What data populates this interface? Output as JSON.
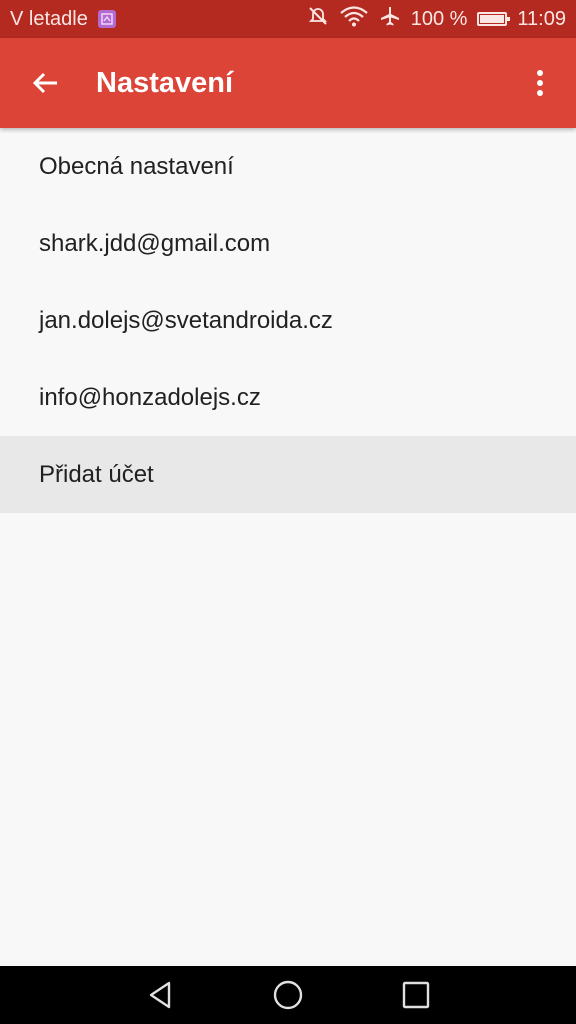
{
  "status_bar": {
    "carrier": "V letadle",
    "battery": "100 %",
    "battery_level": 1.0,
    "time": "11:09",
    "icons": [
      "app-notification-icon",
      "mute-icon",
      "wifi-icon",
      "airplane-icon",
      "battery-icon"
    ]
  },
  "toolbar": {
    "title": "Nastavení",
    "back_icon": "arrow-back-icon",
    "menu_icon": "more-vert-icon"
  },
  "settings_list": {
    "items": [
      {
        "label": "Obecná nastavení"
      },
      {
        "label": "shark.jdd@gmail.com"
      },
      {
        "label": "jan.dolejs@svetandroida.cz"
      },
      {
        "label": "info@honzadolejs.cz"
      },
      {
        "label": "Přidat účet"
      }
    ]
  },
  "nav_bar": {
    "icons": [
      "back-triangle-icon",
      "home-circle-icon",
      "recents-square-icon"
    ]
  },
  "colors": {
    "status_bar": "#b42a21",
    "toolbar": "#dc4438",
    "background": "#f8f8f8",
    "highlight": "#e8e8e8",
    "nav_bar": "#000000"
  }
}
